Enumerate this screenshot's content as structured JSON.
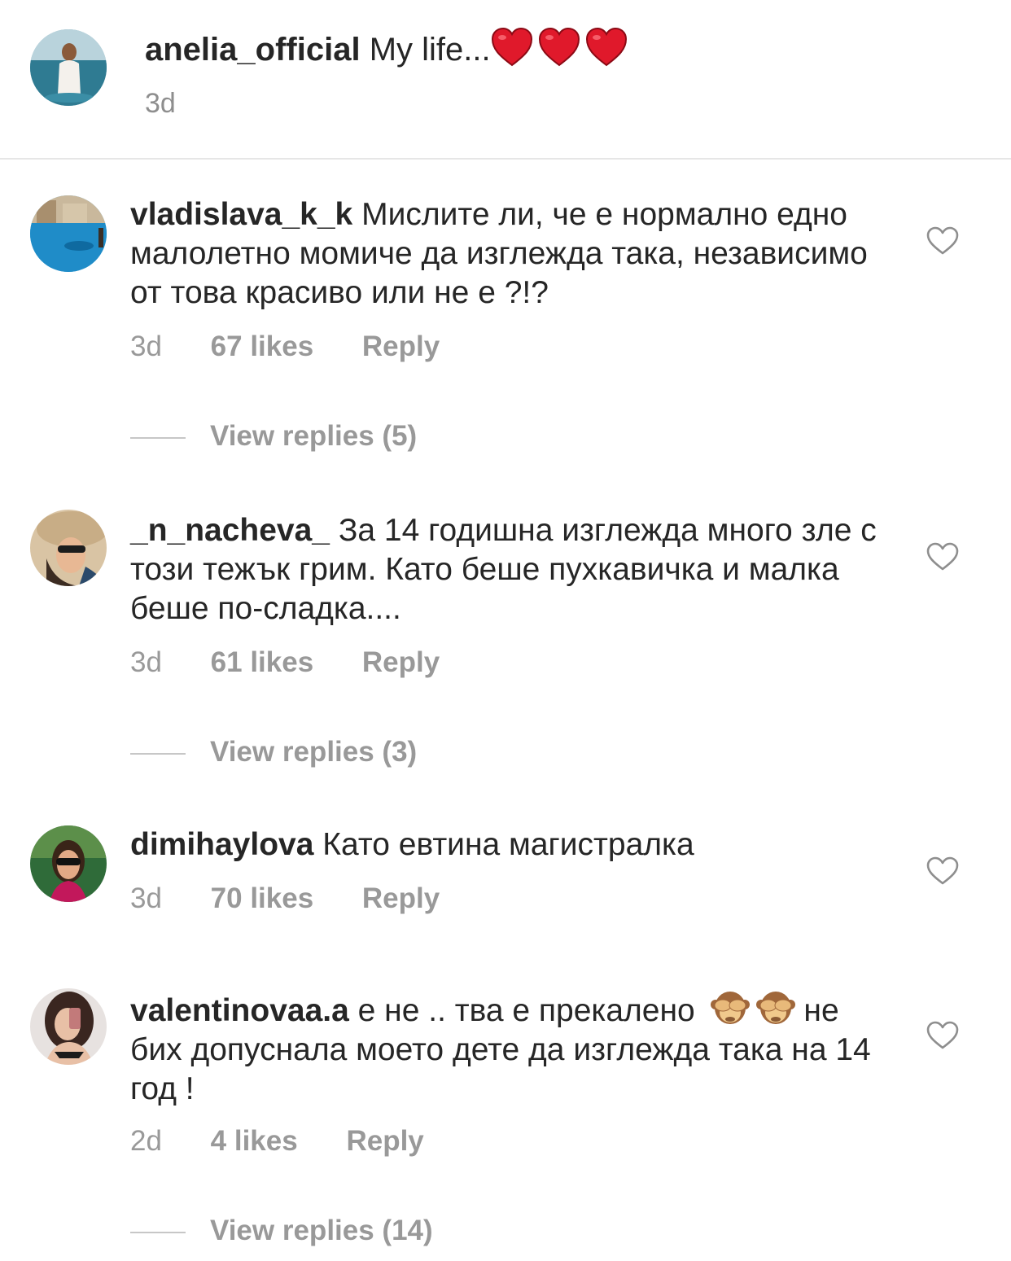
{
  "caption": {
    "username": "anelia_official",
    "text": "My life...",
    "emoji": [
      "heart",
      "heart",
      "heart"
    ],
    "time": "3d"
  },
  "comments": [
    {
      "username": "vladislava_k_k",
      "text": "Мислите ли, че е нормално едно малолетно момиче да изглежда така, независимо от това красиво или не е ?!?",
      "time": "3d",
      "likes": "67 likes",
      "reply": "Reply",
      "view_replies": "View replies (5)"
    },
    {
      "username": "_n_nacheva_",
      "text": "За 14 годишна изглежда много зле с този тежък грим. Като беше пухкавичка и малка беше по-сладка....",
      "time": "3d",
      "likes": "61 likes",
      "reply": "Reply",
      "view_replies": "View replies (3)"
    },
    {
      "username": "dimihaylova",
      "text": "Като евтина магистралка",
      "time": "3d",
      "likes": "70 likes",
      "reply": "Reply"
    },
    {
      "username": "valentinovaa.a",
      "text_before": "е не .. тва е прекалено",
      "emoji": [
        "see-no-evil-monkey",
        "see-no-evil-monkey"
      ],
      "text_after": "не бих допуснала моето дете да изглежда така на 14 год !",
      "time": "2d",
      "likes": "4 likes",
      "reply": "Reply",
      "view_replies": "View replies (14)"
    }
  ],
  "colors": {
    "text": "#262626",
    "secondary": "#999999",
    "divider": "#e6e6e6",
    "heart_emoji": "#e0192b"
  }
}
